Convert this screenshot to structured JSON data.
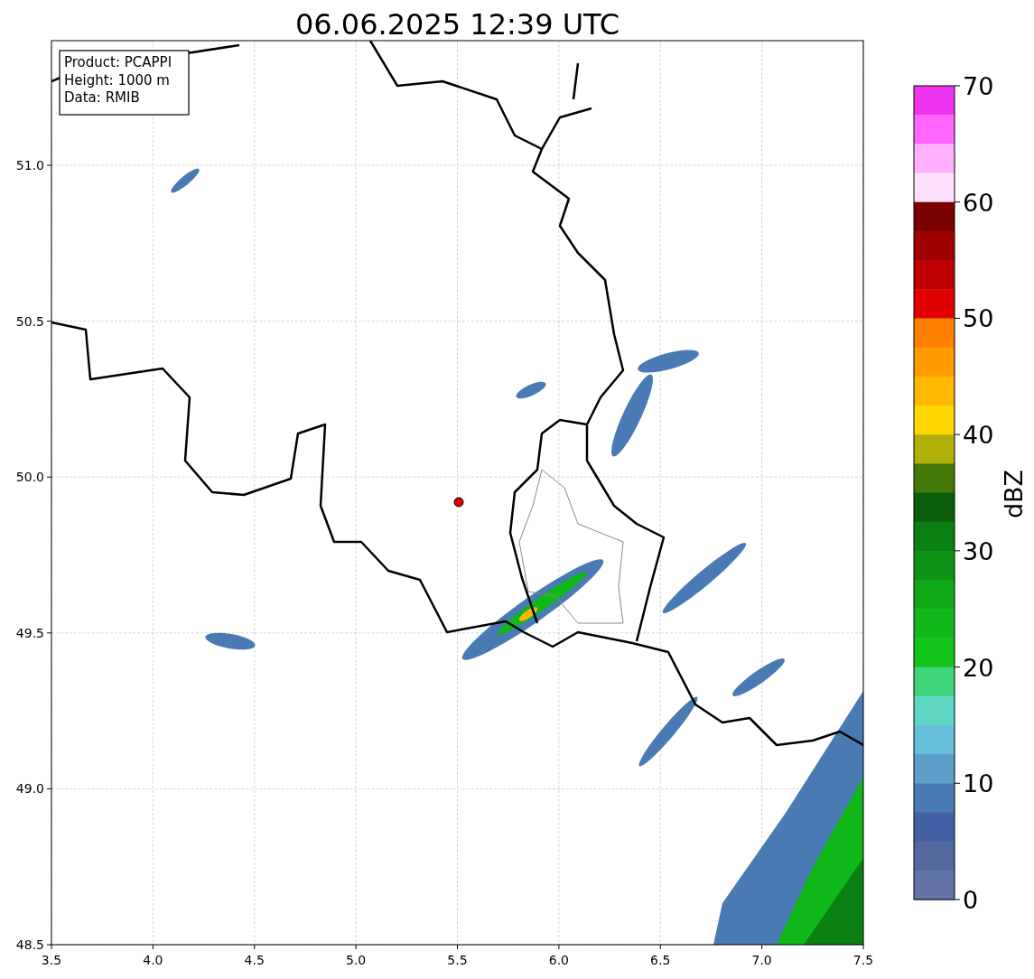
{
  "title": "06.06.2025 12:39 UTC",
  "info_box": [
    "Product: PCAPPI",
    "Height: 1000 m",
    "Data: RMIB"
  ],
  "x_axis": {
    "ticks": [
      "3.5",
      "4.0",
      "4.5",
      "5.0",
      "5.5",
      "6.0",
      "6.5",
      "7.0",
      "7.5"
    ]
  },
  "y_axis": {
    "ticks": [
      "51.0",
      "50.5",
      "50.0",
      "49.5",
      "49.0",
      "48.5"
    ]
  },
  "colorbar": {
    "label": "dBZ",
    "ticks": [
      "70",
      "60",
      "50",
      "40",
      "30",
      "20",
      "10",
      "0"
    ],
    "bins": [
      {
        "color": "#ee33ee"
      },
      {
        "color": "#ff66ff"
      },
      {
        "color": "#ffb0ff"
      },
      {
        "color": "#ffe0ff"
      },
      {
        "color": "#7a0000"
      },
      {
        "color": "#a00000"
      },
      {
        "color": "#c00000"
      },
      {
        "color": "#e00000"
      },
      {
        "color": "#ff7f00"
      },
      {
        "color": "#ff9a00"
      },
      {
        "color": "#ffb800"
      },
      {
        "color": "#ffd700"
      },
      {
        "color": "#b0b008"
      },
      {
        "color": "#447a08"
      },
      {
        "color": "#0a5e0c"
      },
      {
        "color": "#0a8012"
      },
      {
        "color": "#0d9414"
      },
      {
        "color": "#0fa816"
      },
      {
        "color": "#10b81a"
      },
      {
        "color": "#13c41a"
      },
      {
        "color": "#3dd47a"
      },
      {
        "color": "#5fd6c4"
      },
      {
        "color": "#66c0dc"
      },
      {
        "color": "#5b9ec8"
      },
      {
        "color": "#4a7ab4"
      },
      {
        "color": "#4461a6"
      },
      {
        "color": "#53689f"
      },
      {
        "color": "#6374a8"
      }
    ]
  }
}
